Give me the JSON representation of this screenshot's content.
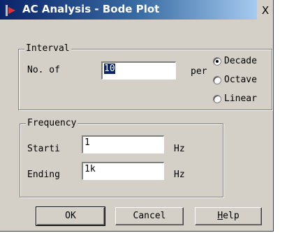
{
  "window": {
    "title": "AC Analysis - Bode Plot",
    "close_glyph": "X"
  },
  "interval": {
    "legend": "Interval",
    "no_of_label": "No. of",
    "no_of_value": "10",
    "per_label": "per",
    "options": [
      {
        "label": "Decade",
        "selected": true
      },
      {
        "label": "Octave",
        "selected": false
      },
      {
        "label": "Linear",
        "selected": false
      }
    ]
  },
  "frequency": {
    "legend": "Frequency",
    "starting_label": "Starti",
    "starting_value": "1",
    "starting_unit": "Hz",
    "ending_label": "Ending",
    "ending_value": "1k",
    "ending_unit": "Hz"
  },
  "buttons": {
    "ok": "OK",
    "cancel": "Cancel",
    "help_prefix": "H",
    "help_rest": "elp"
  }
}
